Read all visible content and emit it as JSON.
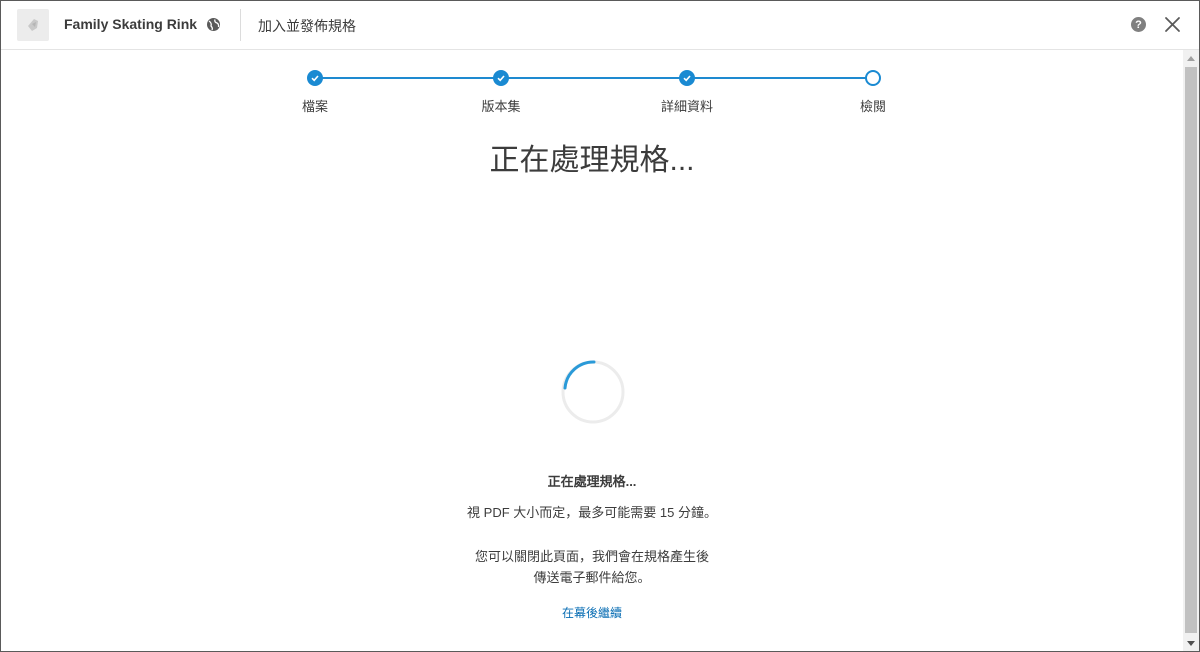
{
  "header": {
    "project_name": "Family Skating Rink",
    "title": "加入並發佈規格",
    "icons": {
      "project": "project-thumbnail-icon",
      "globe": "globe-icon",
      "help": "help-icon",
      "close": "close-icon"
    }
  },
  "stepper": {
    "steps": [
      {
        "label": "檔案",
        "state": "done"
      },
      {
        "label": "版本集",
        "state": "done"
      },
      {
        "label": "詳細資料",
        "state": "done"
      },
      {
        "label": "檢閱",
        "state": "current"
      }
    ],
    "accent": "#1a8ad2"
  },
  "main": {
    "title": "正在處理規格...",
    "status_title": "正在處理規格...",
    "status_line1": "視 PDF 大小而定，最多可能需要 15 分鐘。",
    "status_line2": "您可以關閉此頁面，我們會在規格產生後",
    "status_line3": "傳送電子郵件給您。",
    "background_link": "在幕後繼續"
  }
}
